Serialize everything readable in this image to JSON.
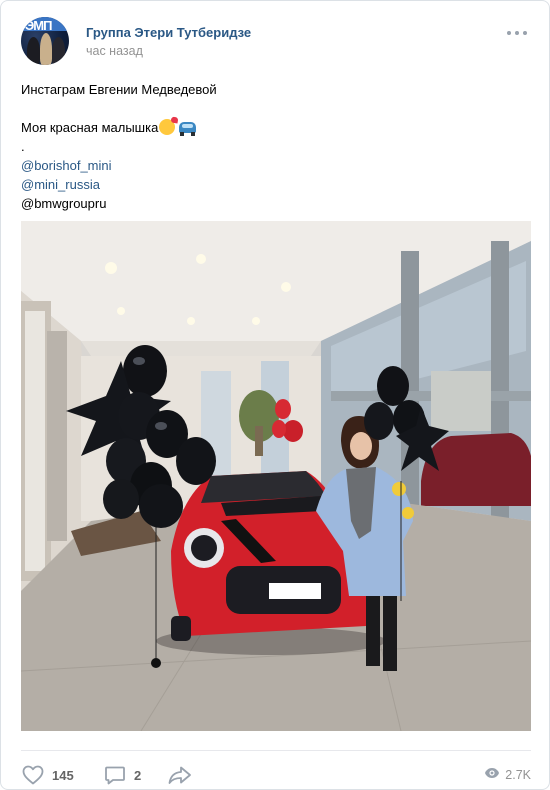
{
  "post": {
    "group_name": "Группа Этери Тутберидзе",
    "avatar_text": "ЭМП",
    "time": "час назад",
    "text_lines": [
      "Инстаграм Евгении Медведевой",
      "Моя красная малышка",
      ".",
      "@borishof_mini",
      "@mini_russia",
      "@bmwgroupru"
    ],
    "icons": {
      "more": "more-horizontal-icon",
      "kiss_emoji": "smiling-face-with-hearts-emoji",
      "car_emoji": "blue-car-emoji",
      "like": "heart-outline-icon",
      "comment": "comment-bubble-icon",
      "share": "share-arrow-icon",
      "views": "eye-icon"
    },
    "photo_alt": "Photo post image"
  },
  "footer": {
    "likes": "145",
    "comments": "2",
    "views": "2.7K"
  },
  "colors": {
    "link": "#2a5885",
    "muted": "#939393",
    "icon": "#99a2ad",
    "car_red": "#d2202a"
  }
}
